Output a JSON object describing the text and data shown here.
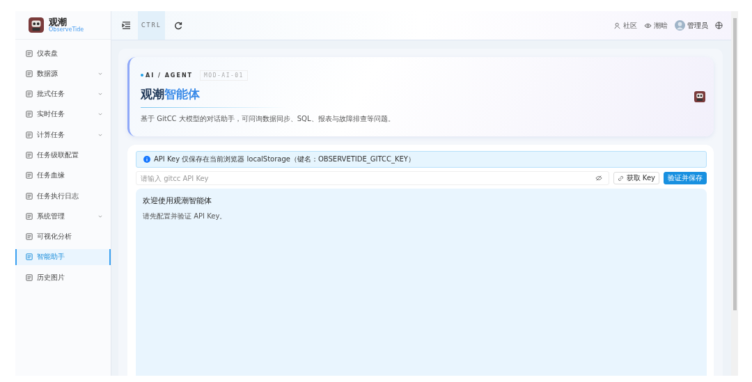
{
  "brand": {
    "title": "观潮",
    "subtitle": "ObserveTide"
  },
  "sidebar": {
    "items": [
      {
        "label": "仪表盘",
        "expandable": false,
        "selected": false
      },
      {
        "label": "数据源",
        "expandable": true,
        "selected": false
      },
      {
        "label": "批式任务",
        "expandable": true,
        "selected": false
      },
      {
        "label": "实时任务",
        "expandable": true,
        "selected": false
      },
      {
        "label": "计算任务",
        "expandable": true,
        "selected": false
      },
      {
        "label": "任务级联配置",
        "expandable": false,
        "selected": false
      },
      {
        "label": "任务血缘",
        "expandable": false,
        "selected": false
      },
      {
        "label": "任务执行日志",
        "expandable": false,
        "selected": false
      },
      {
        "label": "系统管理",
        "expandable": true,
        "selected": false
      },
      {
        "label": "可视化分析",
        "expandable": false,
        "selected": false
      },
      {
        "label": "智能助手",
        "expandable": false,
        "selected": true
      },
      {
        "label": "历史图片",
        "expandable": false,
        "selected": false
      }
    ]
  },
  "header": {
    "ctrl_label": "CTRL",
    "links": [
      "社区",
      "潮暗"
    ],
    "user": "管理员"
  },
  "hero": {
    "tag": "AI / AGENT",
    "code": "MOD-AI-01",
    "title_dark": "观潮",
    "title_accent": "智能体",
    "description": "基于 GitCC 大模型的对话助手，可问询数据同步、SQL、报表与故障排查等问题。"
  },
  "notice": "API Key 仅保存在当前浏览器 localStorage（键名：OBSERVETIDE_GITCC_KEY）",
  "api_key_field": {
    "placeholder": "请输入 gitcc API Key"
  },
  "get_key_button": "获取 Key",
  "save_button": "验证并保存",
  "chat": {
    "title": "欢迎使用观潮智能体",
    "message": "请先配置并验证 API Key。"
  }
}
